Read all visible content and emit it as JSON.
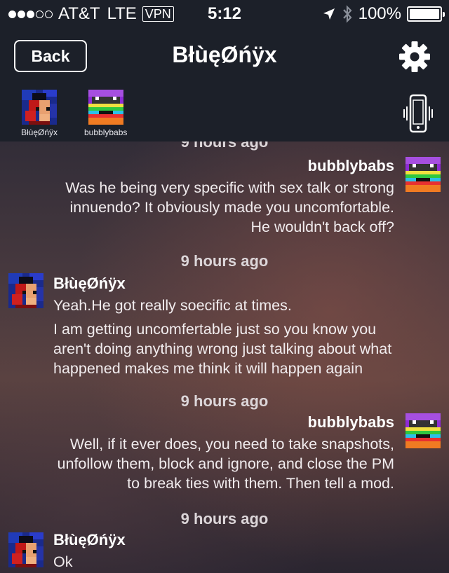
{
  "status_bar": {
    "carrier": "AT&T",
    "network": "LTE",
    "vpn": "VPN",
    "time": "5:12",
    "battery": "100%"
  },
  "nav": {
    "back_label": "Back",
    "title": "BłùęØńÿx"
  },
  "participants": [
    {
      "name": "BłùęØńÿx",
      "avatar": "blue-onyx-avatar"
    },
    {
      "name": "bubblybabs",
      "avatar": "bubblybabs-avatar"
    }
  ],
  "messages": [
    {
      "type": "timestamp",
      "text": "9 hours ago"
    },
    {
      "type": "message",
      "side": "right",
      "sender": "bubblybabs",
      "lines": [
        "Was he being very specific with sex talk or strong",
        "innuendo?  It obviously made you uncomfortable.",
        "He wouldn't back off?"
      ]
    },
    {
      "type": "timestamp",
      "text": "9 hours ago"
    },
    {
      "type": "message",
      "side": "left",
      "sender": "BłùęØńÿx",
      "lines": [
        "Yeah.He got really soecific at times."
      ]
    },
    {
      "type": "message",
      "side": "left",
      "sender": "",
      "lines": [
        "I am getting uncomfertable just so you know you",
        "aren't doing anything wrong just talking about what",
        "happened makes me think it will happen again"
      ]
    },
    {
      "type": "timestamp",
      "text": "9 hours ago"
    },
    {
      "type": "message",
      "side": "right",
      "sender": "bubblybabs",
      "lines": [
        "Well, if it ever does, you need to take snapshots,",
        "unfollow them, block and ignore, and close the PM",
        "to break ties with them.  Then tell a mod."
      ]
    },
    {
      "type": "timestamp",
      "text": "9 hours ago"
    },
    {
      "type": "message",
      "side": "left",
      "sender": "BłùęØńÿx",
      "lines": [
        "Ok"
      ]
    }
  ],
  "colors": {
    "header_bg": "#1c2029",
    "timestamp": "#dcd6d9"
  }
}
